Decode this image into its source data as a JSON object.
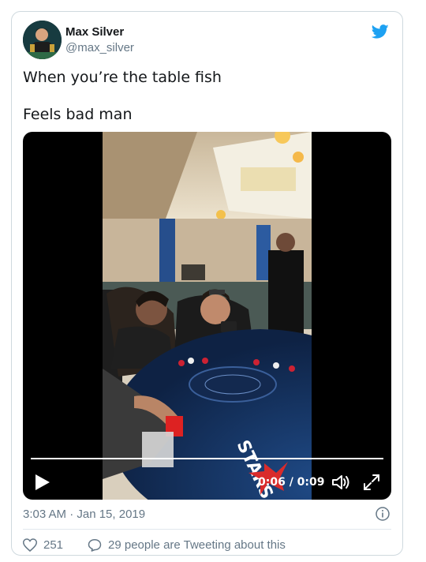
{
  "tweet": {
    "author": {
      "name": "Max Silver",
      "handle": "@max_silver"
    },
    "text_lines": [
      "When you’re the table fish",
      "Feels bad man"
    ],
    "timestamp": "3:03 AM · Jan 15, 2019",
    "likes": "251",
    "tweeting_about": "29 people are Tweeting about this"
  },
  "video": {
    "current_time": "0:06",
    "duration": "0:09",
    "time_display": "0:06 / 0:09",
    "progress_fraction": 0.67,
    "scene_text": "STARS"
  },
  "icons": {
    "bird": "twitter-bird-icon",
    "play": "play-icon",
    "volume": "volume-icon",
    "fullscreen": "fullscreen-icon",
    "info": "info-icon",
    "like": "heart-icon",
    "reply": "speech-bubble-icon"
  },
  "colors": {
    "twitter_blue": "#1da1f2",
    "text": "#14171a",
    "secondary": "#657786",
    "felt": "#1a3a6b"
  }
}
